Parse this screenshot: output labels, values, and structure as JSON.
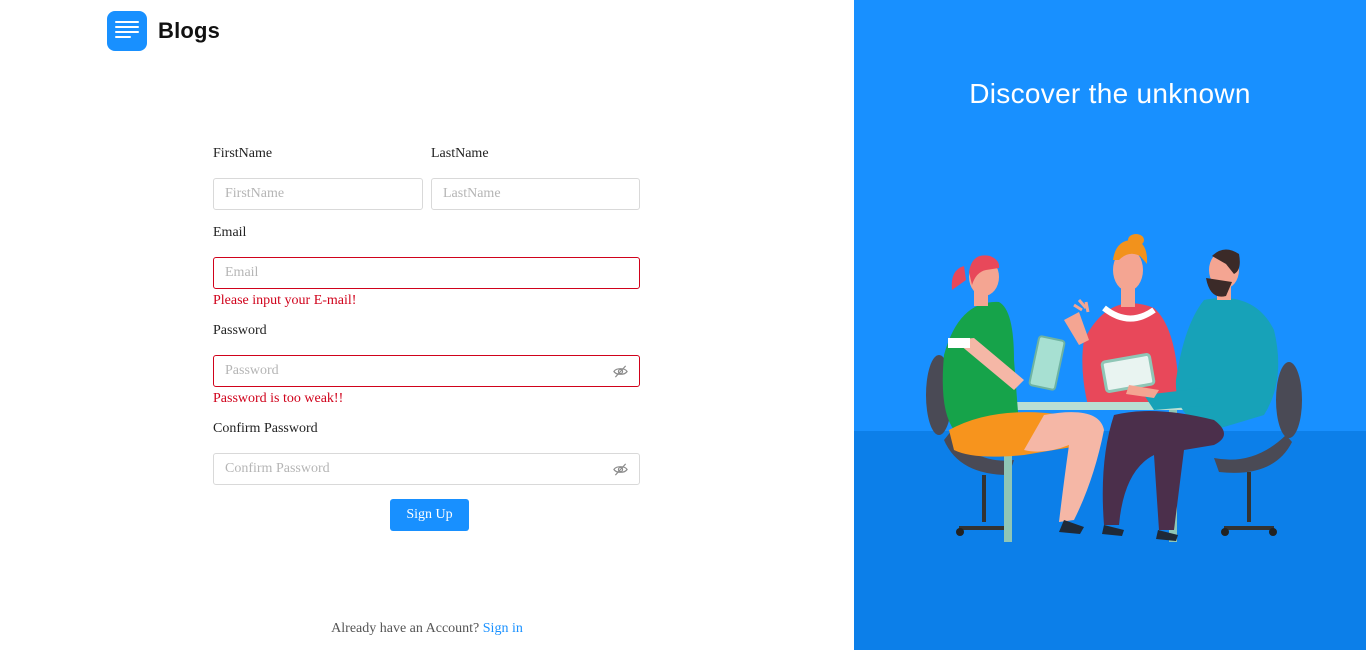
{
  "brand": {
    "name": "Blogs"
  },
  "form": {
    "first_name": {
      "label": "FirstName",
      "placeholder": "FirstName",
      "value": ""
    },
    "last_name": {
      "label": "LastName",
      "placeholder": "LastName",
      "value": ""
    },
    "email": {
      "label": "Email",
      "placeholder": "Email",
      "value": "",
      "error": "Please input your E-mail!"
    },
    "password": {
      "label": "Password",
      "placeholder": "Password",
      "value": "",
      "error": "Password is too weak!!"
    },
    "confirm_password": {
      "label": "Confirm Password",
      "placeholder": "Confirm Password",
      "value": ""
    },
    "submit_label": "Sign Up"
  },
  "footer": {
    "prompt": "Already have an Account?",
    "link": "Sign in"
  },
  "hero": {
    "tagline": "Discover the unknown"
  },
  "icons": {
    "logo": "menu-lines-icon",
    "password_toggle": "eye-invisible-icon"
  },
  "colors": {
    "accent": "#1890ff",
    "error": "#d0021b",
    "hero_bg": "#1890ff"
  }
}
